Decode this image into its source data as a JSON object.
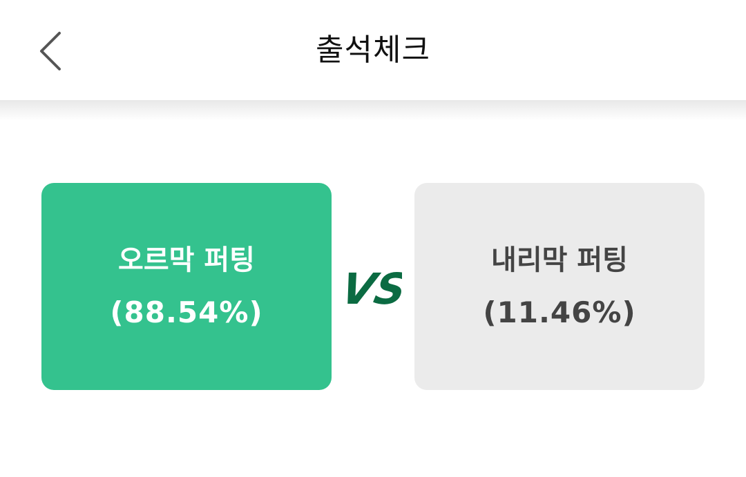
{
  "header": {
    "title": "출석체크",
    "back_icon": "chevron-left-icon"
  },
  "vote": {
    "left": {
      "label": "오르막 퍼팅",
      "percent": "(88.54%)",
      "share_percent": 88.54,
      "selected": true,
      "bg_color": "#34C28E",
      "text_color": "#FFFFFF"
    },
    "vs_label": "VS",
    "vs_color": "#0B6B42",
    "right": {
      "label": "내리막 퍼팅",
      "percent": "(11.46%)",
      "share_percent": 11.46,
      "selected": false,
      "bg_color": "#EBEBEB",
      "text_color": "#444444"
    }
  }
}
